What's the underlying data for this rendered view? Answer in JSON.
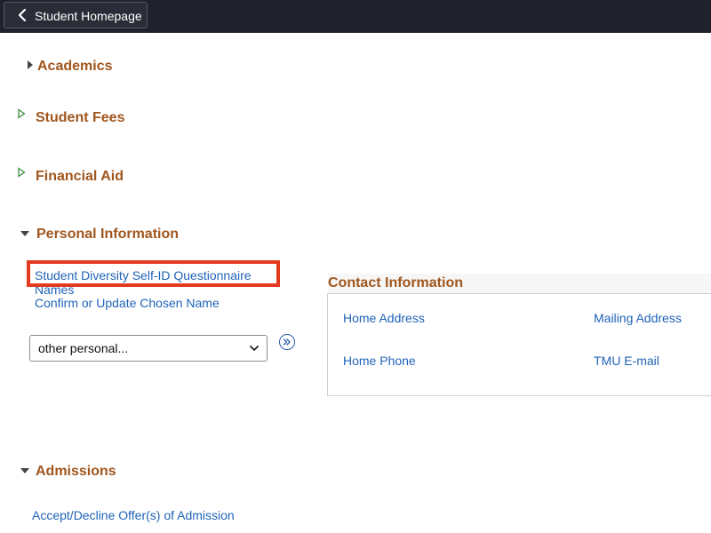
{
  "header": {
    "back_label": "Student Homepage"
  },
  "sections": {
    "academics": "Academics",
    "student_fees": "Student Fees",
    "financial_aid": "Financial Aid",
    "personal_information": "Personal Information",
    "admissions": "Admissions"
  },
  "personal": {
    "links": [
      "Student Diversity Self-ID Questionnaire",
      "Names",
      "Confirm or Update Chosen Name"
    ],
    "select_value": "other personal..."
  },
  "contact": {
    "title": "Contact Information",
    "links": [
      "Home Address",
      "Mailing Address",
      "Home Phone",
      "TMU E-mail"
    ]
  },
  "admissions": {
    "links": [
      "Accept/Decline Offer(s) of Admission"
    ]
  },
  "colors": {
    "topbar": "#1f222b",
    "section_title": "#a0561d",
    "link": "#1f63b7",
    "highlight": "#e23a1f"
  },
  "icons": {
    "back": "chevron-left-icon",
    "collapsed": "triangle-right-icon",
    "expanded": "triangle-down-icon",
    "go": "double-chevron-right-icon",
    "caret": "chevron-down-icon"
  }
}
